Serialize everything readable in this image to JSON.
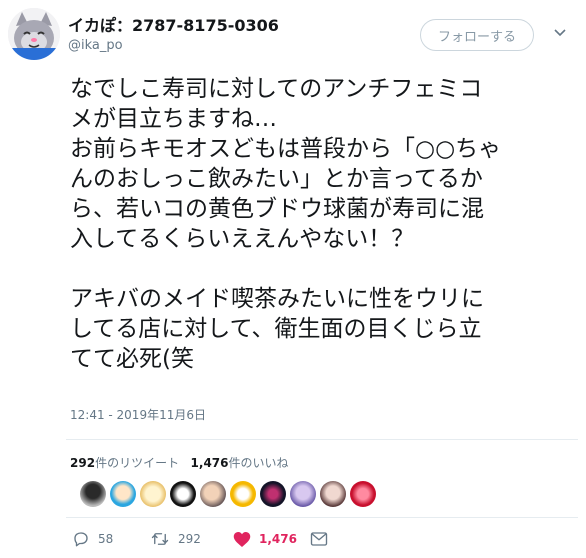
{
  "user": {
    "name": "イカぽ：2787-8175-0306",
    "handle": "@ika_po"
  },
  "follow_label": "フォローする",
  "tweet": {
    "paragraph1": [
      "なでしこ寿司に対してのアンチフェミコ",
      "メが目立ちますね…",
      "お前らキモオスどもは普段から「○○ちゃ",
      "んのおしっこ飲みたい」とか言ってるか",
      "ら、若いコの黄色ブドウ球菌が寿司に混",
      "入してるくらいええんやない！？"
    ],
    "paragraph2": [
      "アキバのメイド喫茶みたいに性をウリに",
      "してる店に対して、衛生面の目くじら立",
      "てて必死(笑"
    ]
  },
  "timestamp": "12:41 - 2019年11月6日",
  "stats": {
    "retweets": "292",
    "retweets_label": "件のリツイート",
    "likes": "1,476",
    "likes_label": "件のいいね"
  },
  "actions": {
    "reply_count": "58",
    "retweet_count": "292",
    "like_count": "1,476"
  },
  "colors": {
    "like": "#e0245e",
    "secondary_text": "#657786",
    "border": "#e6ecf0"
  },
  "icons": [
    "caret-down-icon",
    "reply-icon",
    "retweet-icon",
    "heart-icon",
    "message-icon"
  ]
}
